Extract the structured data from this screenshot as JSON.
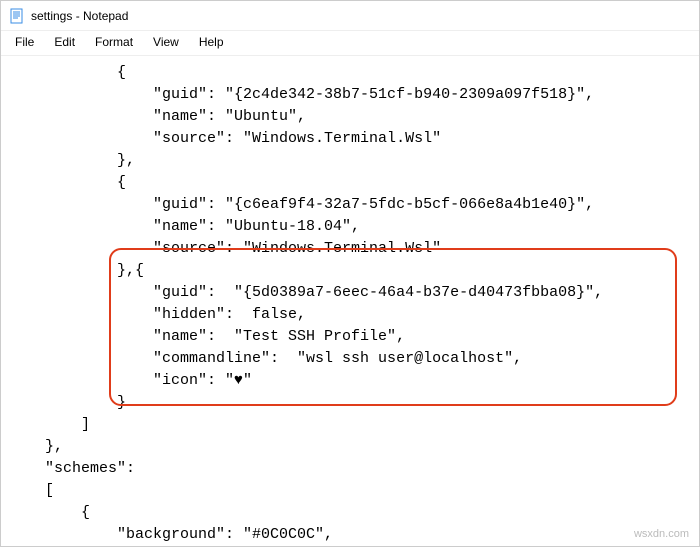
{
  "window": {
    "title": "settings - Notepad"
  },
  "menu": {
    "file": "File",
    "edit": "Edit",
    "format": "Format",
    "view": "View",
    "help": "Help"
  },
  "content": {
    "line1": "            {",
    "line2": "                \"guid\": \"{2c4de342-38b7-51cf-b940-2309a097f518}\",",
    "line3": "                \"name\": \"Ubuntu\",",
    "line4": "                \"source\": \"Windows.Terminal.Wsl\"",
    "line5": "            },",
    "line6": "            {",
    "line7": "                \"guid\": \"{c6eaf9f4-32a7-5fdc-b5cf-066e8a4b1e40}\",",
    "line8": "                \"name\": \"Ubuntu-18.04\",",
    "line9": "                \"source\": \"Windows.Terminal.Wsl\"",
    "line10": "            },{",
    "line11": "                \"guid\":  \"{5d0389a7-6eec-46a4-b37e-d40473fbba08}\",",
    "line12": "                \"hidden\":  false,",
    "line13": "                \"name\":  \"Test SSH Profile\",",
    "line14": "                \"commandline\":  \"wsl ssh user@localhost\",",
    "line15": "                \"icon\": \"♥\"",
    "line16": "            }",
    "line17": "        ]",
    "line18": "    },",
    "line19": "    \"schemes\":",
    "line20": "    [",
    "line21": "        {",
    "line22": "            \"background\": \"#0C0C0C\","
  },
  "watermark": "wsxdn.com"
}
